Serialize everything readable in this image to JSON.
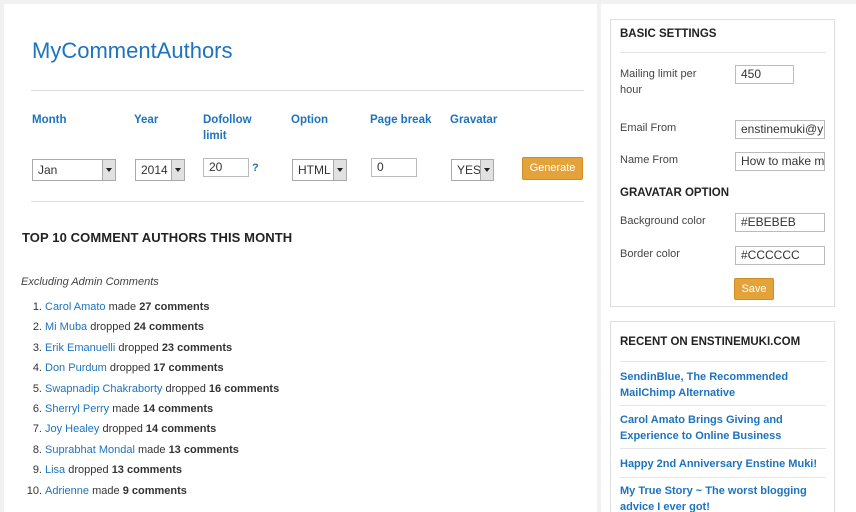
{
  "app": {
    "title": "MyCommentAuthors"
  },
  "filters": {
    "month_label": "Month",
    "year_label": "Year",
    "dofollow_label": "Dofollow limit",
    "option_label": "Option",
    "pagebreak_label": "Page break",
    "gravatar_label": "Gravatar",
    "month_value": "Jan",
    "year_value": "2014",
    "dofollow_value": "20",
    "dofollow_help": "?",
    "option_value": "HTML",
    "pagebreak_value": "0",
    "gravatar_value": "YES",
    "generate_label": "Generate"
  },
  "report": {
    "heading": "TOP 10 COMMENT AUTHORS THIS MONTH",
    "note": "Excluding Admin Comments",
    "authors": [
      {
        "num": "1.",
        "name": "Carol Amato",
        "verb": "made",
        "count": "27 comments"
      },
      {
        "num": "2.",
        "name": "Mi Muba",
        "verb": "dropped",
        "count": "24 comments"
      },
      {
        "num": "3.",
        "name": "Erik Emanuelli",
        "verb": "dropped",
        "count": "23 comments"
      },
      {
        "num": "4.",
        "name": "Don Purdum",
        "verb": "dropped",
        "count": "17 comments"
      },
      {
        "num": "5.",
        "name": "Swapnadip Chakraborty",
        "verb": "dropped",
        "count": "16 comments"
      },
      {
        "num": "6.",
        "name": "Sherryl Perry",
        "verb": "made",
        "count": "14 comments"
      },
      {
        "num": "7.",
        "name": "Joy Healey",
        "verb": "dropped",
        "count": "14 comments"
      },
      {
        "num": "8.",
        "name": "Suprabhat Mondal",
        "verb": "made",
        "count": "13 comments"
      },
      {
        "num": "9.",
        "name": "Lisa",
        "verb": "dropped",
        "count": "13 comments"
      },
      {
        "num": "10.",
        "name": "Adrienne",
        "verb": "made",
        "count": "9 comments"
      }
    ]
  },
  "settings": {
    "title": "BASIC SETTINGS",
    "mailing_limit_label": "Mailing limit per hour",
    "mailing_limit_value": "450",
    "email_from_label": "Email From",
    "email_from_value": "enstinemuki@y",
    "name_from_label": "Name From",
    "name_from_value": "How to make m",
    "gravatar_option_title": "GRAVATAR OPTION",
    "bg_color_label": "Background color",
    "bg_color_value": "#EBEBEB",
    "border_color_label": "Border color",
    "border_color_value": "#CCCCCC",
    "save_label": "Save"
  },
  "recent": {
    "title": "RECENT ON ENSTINEMUKI.COM",
    "posts": [
      "SendinBlue, The Recommended MailChimp Alternative",
      "Carol Amato Brings Giving and Experience to Online Business",
      "Happy 2nd Anniversary Enstine Muki!",
      "My True Story ~ The worst blogging advice I ever got!"
    ]
  },
  "colors": {
    "link": "#1e73be",
    "button": "#e4a33a",
    "background": "#f1f1f1"
  }
}
